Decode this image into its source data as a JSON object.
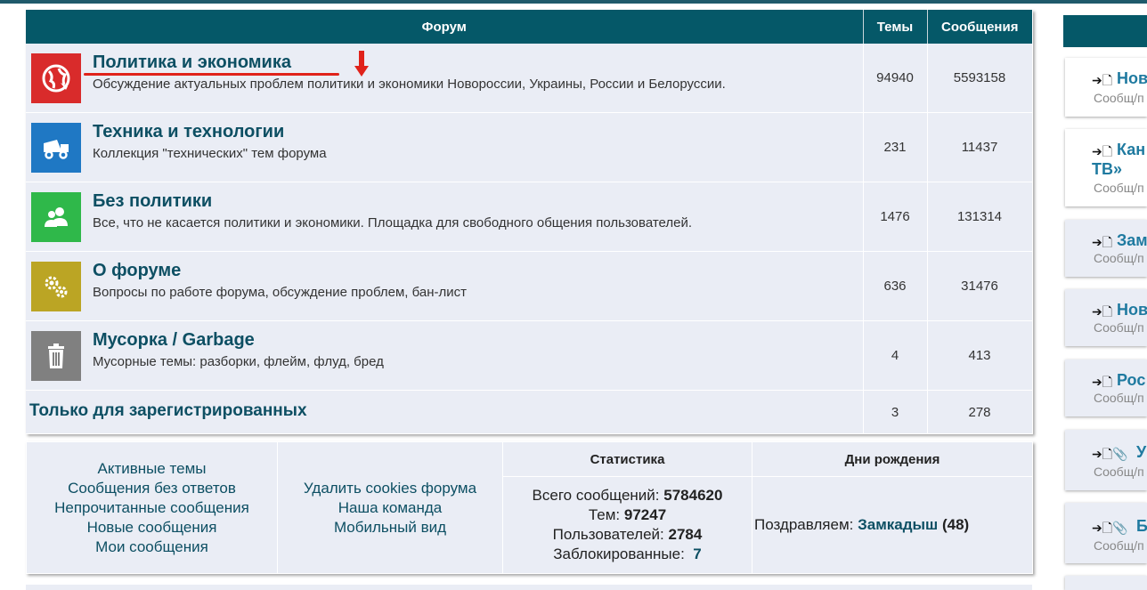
{
  "forum_table": {
    "headers": {
      "forum": "Форум",
      "topics": "Темы",
      "posts": "Сообщения"
    },
    "rows": [
      {
        "title": "Политика и экономика",
        "description": "Обсуждение актуальных проблем политики и экономики Новороссии, Украины, России и Белоруссии.",
        "topics": "94940",
        "posts": "5593158",
        "icon": "globe-icon",
        "color": "#d92b2b"
      },
      {
        "title": "Техника и технологии",
        "description": "Коллекция \"технических\" тем форума",
        "topics": "231",
        "posts": "11437",
        "icon": "dump-truck-icon",
        "color": "#1f78c4"
      },
      {
        "title": "Без политики",
        "description": "Все, что не касается политики и экономики. Площадка для свободного общения пользователей.",
        "topics": "1476",
        "posts": "131314",
        "icon": "users-icon",
        "color": "#2fb84a"
      },
      {
        "title": "О форуме",
        "description": "Вопросы по работе форума, обсуждение проблем, бан-лист",
        "topics": "636",
        "posts": "31476",
        "icon": "gears-icon",
        "color": "#bba524"
      },
      {
        "title": "Мусорка / Garbage",
        "description": "Мусорные темы: разборки, флейм, флуд, бред",
        "topics": "4",
        "posts": "413",
        "icon": "trash-icon",
        "color": "#808080"
      }
    ],
    "registered_only": {
      "title": "Только для зарегистрированных",
      "topics": "3",
      "posts": "278"
    }
  },
  "quick_links": {
    "col1": [
      "Активные темы",
      "Сообщения без ответов",
      "Непрочитанные сообщения",
      "Новые сообщения",
      "Мои сообщения"
    ],
    "col2": [
      "Удалить cookies форума",
      "Наша команда",
      "Мобильный вид"
    ]
  },
  "statistics": {
    "header": "Статистика",
    "total_posts_label": "Всего сообщений:",
    "total_posts": "5784620",
    "topics_label": "Тем:",
    "topics": "97247",
    "users_label": "Пользователей:",
    "users": "2784",
    "banned_label": "Заблокированные:",
    "banned": "7"
  },
  "birthdays": {
    "header": "Дни рождения",
    "text": "Поздравляем:",
    "name": "Замкадыш",
    "age": "(48)"
  },
  "sidebar": {
    "cards": [
      {
        "title": "Нов",
        "sub": "Сообщ/п"
      },
      {
        "title": "Кан",
        "title2": "ТВ»",
        "sub": "Сообщ/п"
      },
      {
        "title": "Зам",
        "sub": "Сообщ/п"
      },
      {
        "title": "Нов",
        "sub": "Сообщ/п"
      },
      {
        "title": "Рос",
        "sub": "Сообщ/п"
      },
      {
        "title": "У",
        "sub": "Сообщ/п"
      },
      {
        "title": "Б",
        "sub": "Сообщ/п"
      }
    ]
  },
  "colors": {
    "header_bg": "#055868",
    "row_bg": "#eaedf5",
    "link": "#0d4f63",
    "annotation": "#e0221a"
  }
}
